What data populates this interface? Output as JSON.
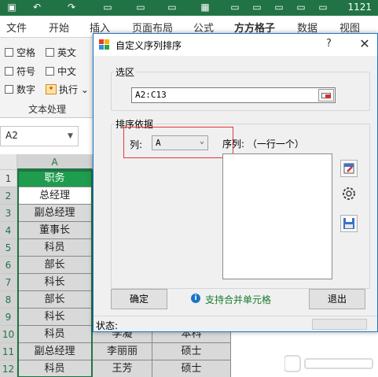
{
  "excel": {
    "title_fragment": "1121",
    "menu": [
      "文件",
      "开始",
      "插入",
      "页面布局",
      "公式",
      "方方格子",
      "数据",
      "视图"
    ],
    "ribbon_checks": [
      {
        "label": "空格"
      },
      {
        "label": "英文"
      },
      {
        "label": "符号"
      },
      {
        "label": "中文"
      },
      {
        "label": "数字"
      },
      {
        "label": "执行 ⌄"
      }
    ],
    "ribbon_group_label": "文本处理",
    "name_box": "A2",
    "column_header": "A",
    "row_numbers": [
      "1",
      "2",
      "3",
      "4",
      "5",
      "6",
      "7",
      "8",
      "9",
      "10",
      "11",
      "12"
    ],
    "col_a": [
      "职务",
      "总经理",
      "副总经理",
      "董事长",
      "科员",
      "部长",
      "科长",
      "部长",
      "科长",
      "科员",
      "副总经理",
      "科员"
    ],
    "col_b_partial": [
      "",
      "",
      "",
      "",
      "",
      "",
      "",
      "",
      "",
      "李凝",
      "李丽丽",
      "王芳"
    ],
    "col_c_partial": [
      "",
      "",
      "",
      "",
      "",
      "",
      "",
      "",
      "",
      "本科",
      "硕士",
      "硕士"
    ]
  },
  "dialog": {
    "title": "自定义序列排序",
    "help": "?",
    "close": "✕",
    "range_group_label": "选区",
    "range_value": "A2:C13",
    "sort_group_label": "排序依据",
    "column_label": "列:",
    "column_value": "A",
    "sequence_label": "序列: （一行一个）",
    "confirm_button": "确定",
    "info_text": "支持合并单元格",
    "exit_button": "退出",
    "status_label": "状态:"
  },
  "colors": {
    "excel_green": "#217346",
    "header_green": "#1f9c4e",
    "highlight_red": "#e53935",
    "info_green": "#1a7a2e"
  }
}
